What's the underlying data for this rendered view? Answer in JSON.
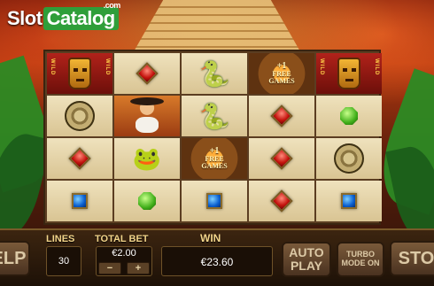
{
  "logo": {
    "slot": "Slot",
    "catalog": "Catalog",
    "com": ".com"
  },
  "reels": {
    "rows": [
      [
        "wild-mask",
        "red-gem",
        "snake",
        "free-games",
        "wild-mask"
      ],
      [
        "gold-disc",
        "conquistador",
        "snake",
        "red-gem",
        "green-gem"
      ],
      [
        "red-gem",
        "blue-frog",
        "free-games",
        "red-gem",
        "gold-disc"
      ],
      [
        "blue-gem",
        "green-gem",
        "blue-gem",
        "red-gem",
        "blue-gem"
      ]
    ],
    "wild_label": "WILD",
    "free_games": {
      "plus": "+1",
      "free": "FREE",
      "games": "GAMES"
    }
  },
  "controls": {
    "help_label": "ELP",
    "lines_label": "LINES",
    "lines_value": "30",
    "total_bet_label": "TOTAL BET",
    "total_bet_value": "€2.00",
    "minus_label": "−",
    "plus_label": "+",
    "win_label": "WIN",
    "win_value": "€23.60",
    "auto_play_label": "AUTO PLAY",
    "turbo_label": "TURBO MODE ON",
    "stop_label": "STO"
  },
  "colors": {
    "brand_green": "#2f9e3a",
    "label_gold": "#f3d58a",
    "reel_cream": "#efe2bd"
  }
}
